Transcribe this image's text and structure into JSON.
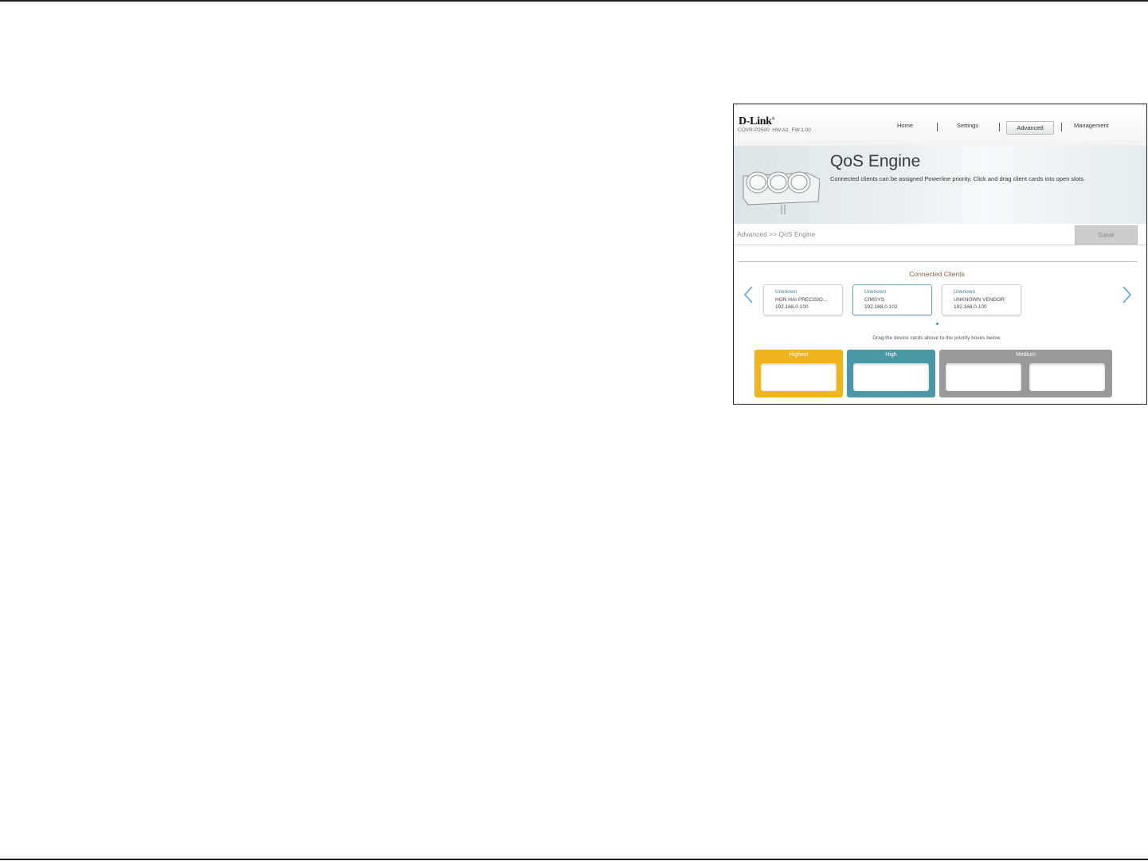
{
  "brand": {
    "logo": "D-Link",
    "model": "COVR-P2500",
    "hw": "HW:A1",
    "fw": "FW:1.00"
  },
  "nav": {
    "home": "Home",
    "settings": "Settings",
    "advanced": "Advanced",
    "management": "Management"
  },
  "page": {
    "title": "QoS Engine",
    "description": "Connected clients can be assigned Powerline priority. Click and drag client cards into open slots.",
    "breadcrumb": "Advanced >> QoS Engine",
    "save_label": "Save"
  },
  "clients": {
    "title": "Connected Clients",
    "items": [
      {
        "name": "Unknown",
        "vendor": "HON HAI PRECISIO...",
        "ip": "192.168.0.100"
      },
      {
        "name": "Unknown",
        "vendor": "CIMSYS",
        "ip": "192.168.0.102"
      },
      {
        "name": "Unknown",
        "vendor": "UNKNOWN VENDOR",
        "ip": "192.168.0.100"
      }
    ],
    "hint": "Drag the device cards above to the priority boxes below."
  },
  "priorities": {
    "highest": "Highest",
    "high": "High",
    "medium": "Medium"
  },
  "colors": {
    "highest": "#f0b41e",
    "high": "#4a97a6",
    "medium": "#999999",
    "accent": "#6aaed8"
  }
}
